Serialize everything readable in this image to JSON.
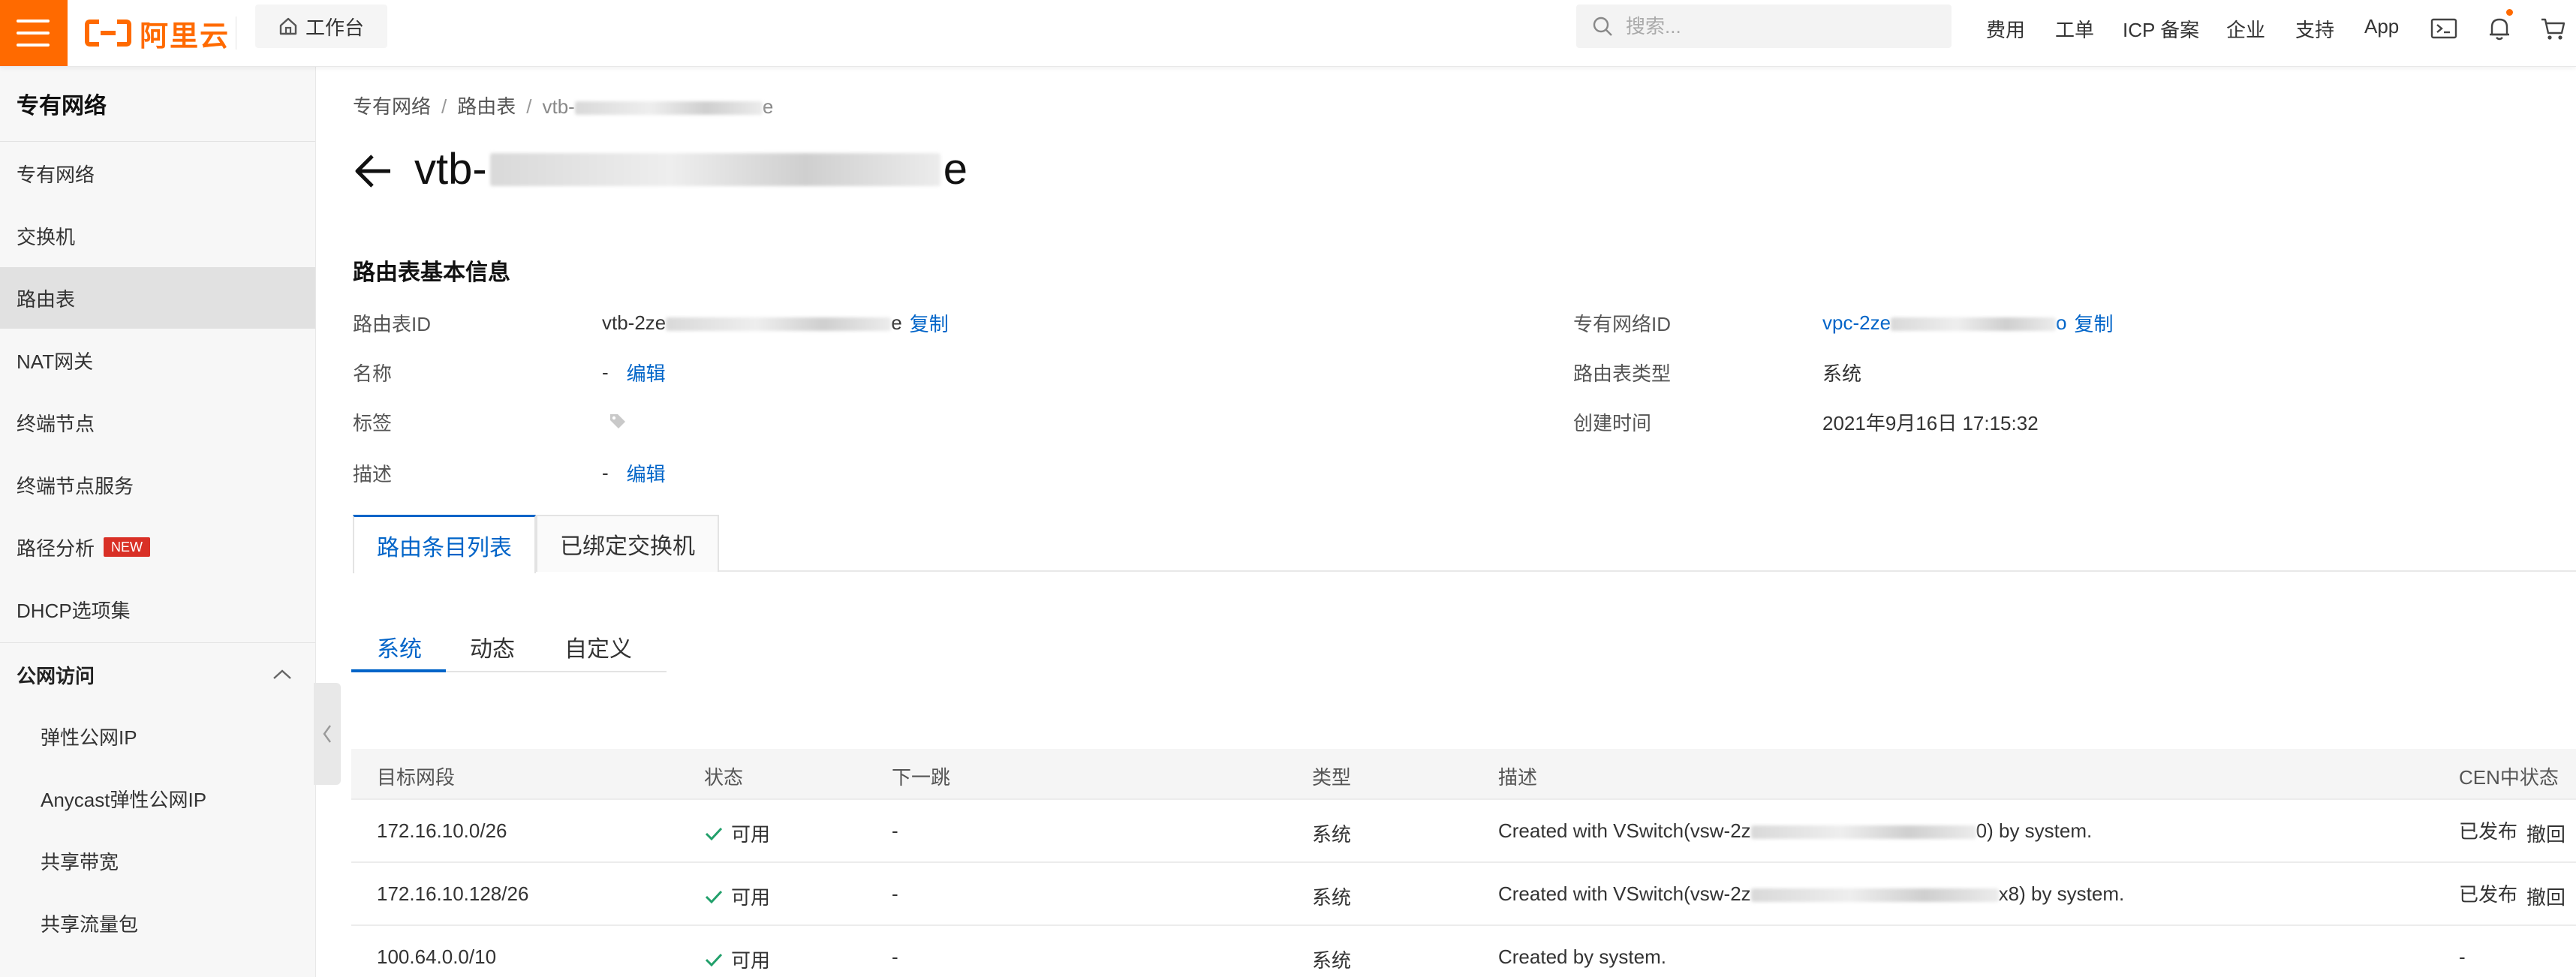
{
  "topbar": {
    "logo_text": "阿里云",
    "workbench": "工作台",
    "search_placeholder": "搜索...",
    "nav": [
      "费用",
      "工单",
      "ICP 备案",
      "企业",
      "支持",
      "App"
    ]
  },
  "sidebar": {
    "title": "专有网络",
    "items": [
      "专有网络",
      "交换机",
      "路由表",
      "NAT网关",
      "终端节点",
      "终端节点服务",
      "路径分析",
      "DHCP选项集"
    ],
    "new_badge": "NEW",
    "group": "公网访问",
    "sub_items": [
      "弹性公网IP",
      "Anycast弹性公网IP",
      "共享带宽",
      "共享流量包"
    ]
  },
  "breadcrumb": {
    "items": [
      "专有网络",
      "路由表"
    ],
    "current_prefix": "vtb-",
    "current_suffix": "e"
  },
  "page": {
    "title_prefix": "vtb-",
    "title_suffix": "e"
  },
  "info": {
    "section_title": "路由表基本信息",
    "id_label": "路由表ID",
    "id_prefix": "vtb-2ze",
    "id_suffix": "e",
    "copy": "复制",
    "name_label": "名称",
    "name_value": "-",
    "edit": "编辑",
    "tag_label": "标签",
    "desc_label": "描述",
    "desc_value": "-",
    "vpc_label": "专有网络ID",
    "vpc_prefix": "vpc-2ze",
    "vpc_suffix": "o",
    "type_label": "路由表类型",
    "type_value": "系统",
    "created_label": "创建时间",
    "created_value": "2021年9月16日 17:15:32"
  },
  "tabs": [
    "路由条目列表",
    "已绑定交换机"
  ],
  "subtabs": [
    "系统",
    "动态",
    "自定义"
  ],
  "table": {
    "headers": [
      "目标网段",
      "状态",
      "下一跳",
      "类型",
      "描述",
      "CEN中状态"
    ],
    "rows": [
      {
        "cidr": "172.16.10.0/26",
        "status": "可用",
        "next_hop": "-",
        "type": "系统",
        "desc_prefix": "Created with VSwitch(vsw-2z",
        "desc_suffix": "0) by system.",
        "cen": "已发布",
        "action": "撤回"
      },
      {
        "cidr": "172.16.10.128/26",
        "status": "可用",
        "next_hop": "-",
        "type": "系统",
        "desc_prefix": "Created with VSwitch(vsw-2z",
        "desc_suffix": "x8) by system.",
        "cen": "已发布",
        "action": "撤回"
      },
      {
        "cidr": "100.64.0.0/10",
        "status": "可用",
        "next_hop": "-",
        "type": "系统",
        "desc_prefix": "Created by system.",
        "desc_suffix": "",
        "cen": "-",
        "action": ""
      }
    ]
  },
  "colors": {
    "brand": "#ff6a00",
    "link": "#0064c8",
    "success": "#22a06b",
    "badge": "#d93026"
  }
}
